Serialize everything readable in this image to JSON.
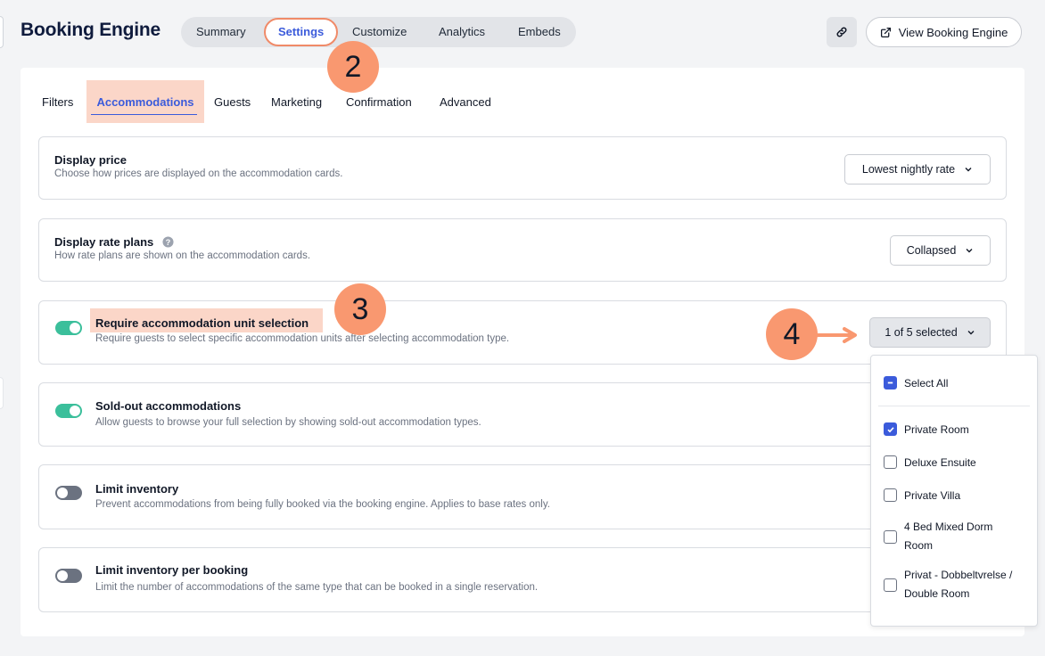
{
  "header": {
    "title": "Booking Engine",
    "tabs": [
      "Summary",
      "Settings",
      "Customize",
      "Analytics",
      "Embeds"
    ],
    "active_tab": "Settings",
    "view_button_label": "View Booking Engine"
  },
  "subtabs": [
    "Filters",
    "Accommodations",
    "Guests",
    "Marketing",
    "Confirmation",
    "Advanced"
  ],
  "active_subtab": "Accommodations",
  "cards": {
    "display_price": {
      "title": "Display price",
      "desc": "Choose how prices are displayed on the accommodation cards.",
      "value": "Lowest nightly rate"
    },
    "display_rate_plans": {
      "title": "Display rate plans",
      "desc": "How rate plans are shown on the accommodation cards.",
      "value": "Collapsed"
    },
    "require_unit": {
      "title": "Require accommodation unit selection",
      "desc": "Require guests to select specific accommodation units after selecting accommodation type.",
      "enabled": true,
      "value": "1 of 5 selected"
    },
    "sold_out": {
      "title": "Sold-out accommodations",
      "desc": "Allow guests to browse your full selection by showing sold-out accommodation types.",
      "enabled": true
    },
    "limit_inventory": {
      "title": "Limit inventory",
      "desc": "Prevent accommodations from being fully booked via the booking engine. Applies to base rates only.",
      "enabled": false
    },
    "limit_per_booking": {
      "title": "Limit inventory per booking",
      "desc": "Limit the number of accommodations of the same type that can be booked in a single reservation.",
      "enabled": false
    }
  },
  "dropdown": {
    "select_all": "Select All",
    "items": [
      {
        "label_lines": [
          "Private Room"
        ],
        "checked": true
      },
      {
        "label_lines": [
          "Deluxe Ensuite"
        ],
        "checked": false
      },
      {
        "label_lines": [
          "Private Villa"
        ],
        "checked": false
      },
      {
        "label_lines": [
          "4 Bed Mixed Dorm",
          "Room"
        ],
        "checked": false
      },
      {
        "label_lines": [
          "Privat - Dobbeltvrelse /",
          "Double Room"
        ],
        "checked": false
      }
    ]
  },
  "steps": [
    "2",
    "3",
    "4"
  ],
  "colors": {
    "accent": "#3b5bdb",
    "toggle_on": "#3bbf9b",
    "highlight": "#fbd6c8",
    "badge": "#f99870"
  }
}
